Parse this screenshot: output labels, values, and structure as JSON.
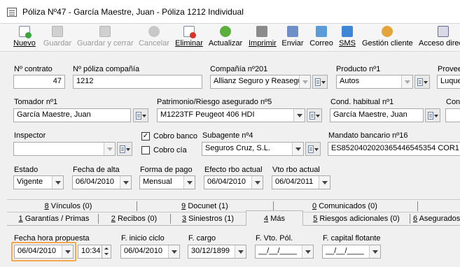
{
  "window": {
    "title": "Póliza Nº47 - García Maestre, Juan - Póliza 1212 Individual"
  },
  "toolbar": {
    "nuevo": "Nuevo",
    "guardar": "Guardar",
    "guardar_cerrar": "Guardar y cerrar",
    "cancelar": "Cancelar",
    "eliminar": "Eliminar",
    "actualizar": "Actualizar",
    "imprimir": "Imprimir",
    "enviar": "Enviar",
    "correo": "Correo",
    "sms": "SMS",
    "gestion_cliente": "Gestión cliente",
    "acceso": "Acceso direc"
  },
  "fields": {
    "contrato_label": "Nº contrato",
    "contrato_value": "47",
    "poliza_label": "Nº póliza compañía",
    "poliza_value": "1212",
    "compania_label": "Compañía nº201",
    "compania_value": "Allianz Seguro y Reasegu",
    "producto_label": "Producto nº1",
    "producto_value": "Autos",
    "proveedor_label": "Provee",
    "proveedor_value": "Luque",
    "tomador_label": "Tomador nº1",
    "tomador_value": "García Maestre, Juan",
    "patrimonio_label": "Patrimonio/Riesgo asegurado nº5",
    "patrimonio_value": "M1223TF Peugeot 406 HDI",
    "conductor_label": "Cond. habitual nº1",
    "conductor_value": "García Maestre, Juan",
    "cond2_label": "Cond",
    "inspector_label": "Inspector",
    "inspector_value": "",
    "cobro_banco_label": "Cobro banco",
    "cobro_banco_checked": "✓",
    "cobro_cia_label": "Cobro cía",
    "subagente_label": "Subagente nº4",
    "subagente_value": "Seguros Cruz, S.L.",
    "mandato_label": "Mandato bancario nº16",
    "mandato_value": "ES85204020203654465453​54 COR1",
    "estado_label": "Estado",
    "estado_value": "Vigente",
    "alta_label": "Fecha de alta",
    "alta_value": "06/04/2010",
    "pago_label": "Forma de pago",
    "pago_value": "Mensual",
    "efecto_label": "Efecto rbo actual",
    "efecto_value": "06/04/2010",
    "vto_label": "Vto rbo actual",
    "vto_value": "06/04/2011"
  },
  "tabs_row1": [
    {
      "key": "8",
      "rest": " Vínculos (0)"
    },
    {
      "key": "9",
      "rest": " Docunet (1)"
    },
    {
      "key": "0",
      "rest": " Comunicados (0)"
    }
  ],
  "tabs_row2": [
    {
      "key": "1",
      "rest": " Garantías / Primas"
    },
    {
      "key": "2",
      "rest": " Recibos (0)"
    },
    {
      "key": "3",
      "rest": " Siniestros (1)"
    },
    {
      "key": "4",
      "rest": " Más"
    },
    {
      "key": "5",
      "rest": " Riesgos adicionales (0)"
    },
    {
      "key": "6",
      "rest": " Asegurados"
    }
  ],
  "mas": {
    "propuesta_label": "Fecha hora propuesta",
    "propuesta_date": "06/04/2010",
    "propuesta_time": "10:34",
    "inicio_label": "F. inicio ciclo",
    "inicio_value": "06/04/2010",
    "cargo_label": "F. cargo",
    "cargo_value": "30/12/1899",
    "vto_pol_label": "F. Vto. Pól.",
    "vto_pol_value": "__/__/____",
    "flotante_label": "F. capital flotante",
    "flotante_value": "__/__/____"
  },
  "colors": {
    "accent_focus": "#f5a850",
    "title_bg": "#ffffff",
    "panel_bg": "#f0f0f0"
  }
}
